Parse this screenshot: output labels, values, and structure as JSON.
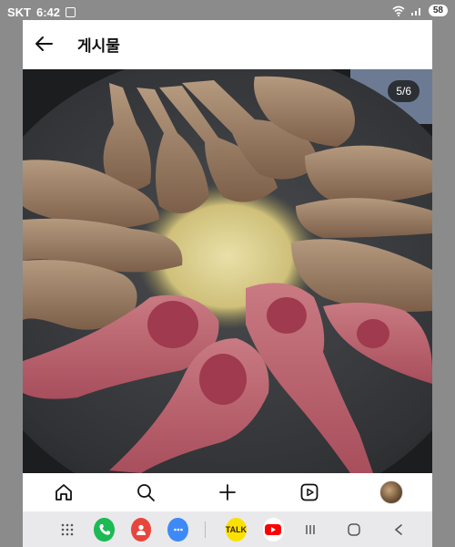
{
  "status_bar": {
    "carrier": "SKT",
    "time": "6:42",
    "battery": "58"
  },
  "header": {
    "back_icon": "arrow-left-icon",
    "title": "게시물"
  },
  "post": {
    "image_counter": "5/6",
    "image_description_icon": "lamb-chops-photo"
  },
  "bottom_nav": {
    "items": [
      "home-icon",
      "search-icon",
      "plus-icon",
      "reels-icon",
      "profile-avatar"
    ]
  },
  "dock": {
    "apps": [
      {
        "name": "apps-grid-icon",
        "color": "#e9e9eb"
      },
      {
        "name": "phone-icon",
        "color": "#1db954"
      },
      {
        "name": "contacts-icon",
        "color": "#e8453c"
      },
      {
        "name": "messages-icon",
        "color": "#3d8af7"
      },
      {
        "name": "kakaotalk-icon",
        "color": "#fae100",
        "label": "TALK"
      },
      {
        "name": "youtube-icon",
        "color": "#ff0000"
      }
    ],
    "system": [
      "recents-icon",
      "home-circle-icon",
      "back-chevron-icon"
    ]
  }
}
